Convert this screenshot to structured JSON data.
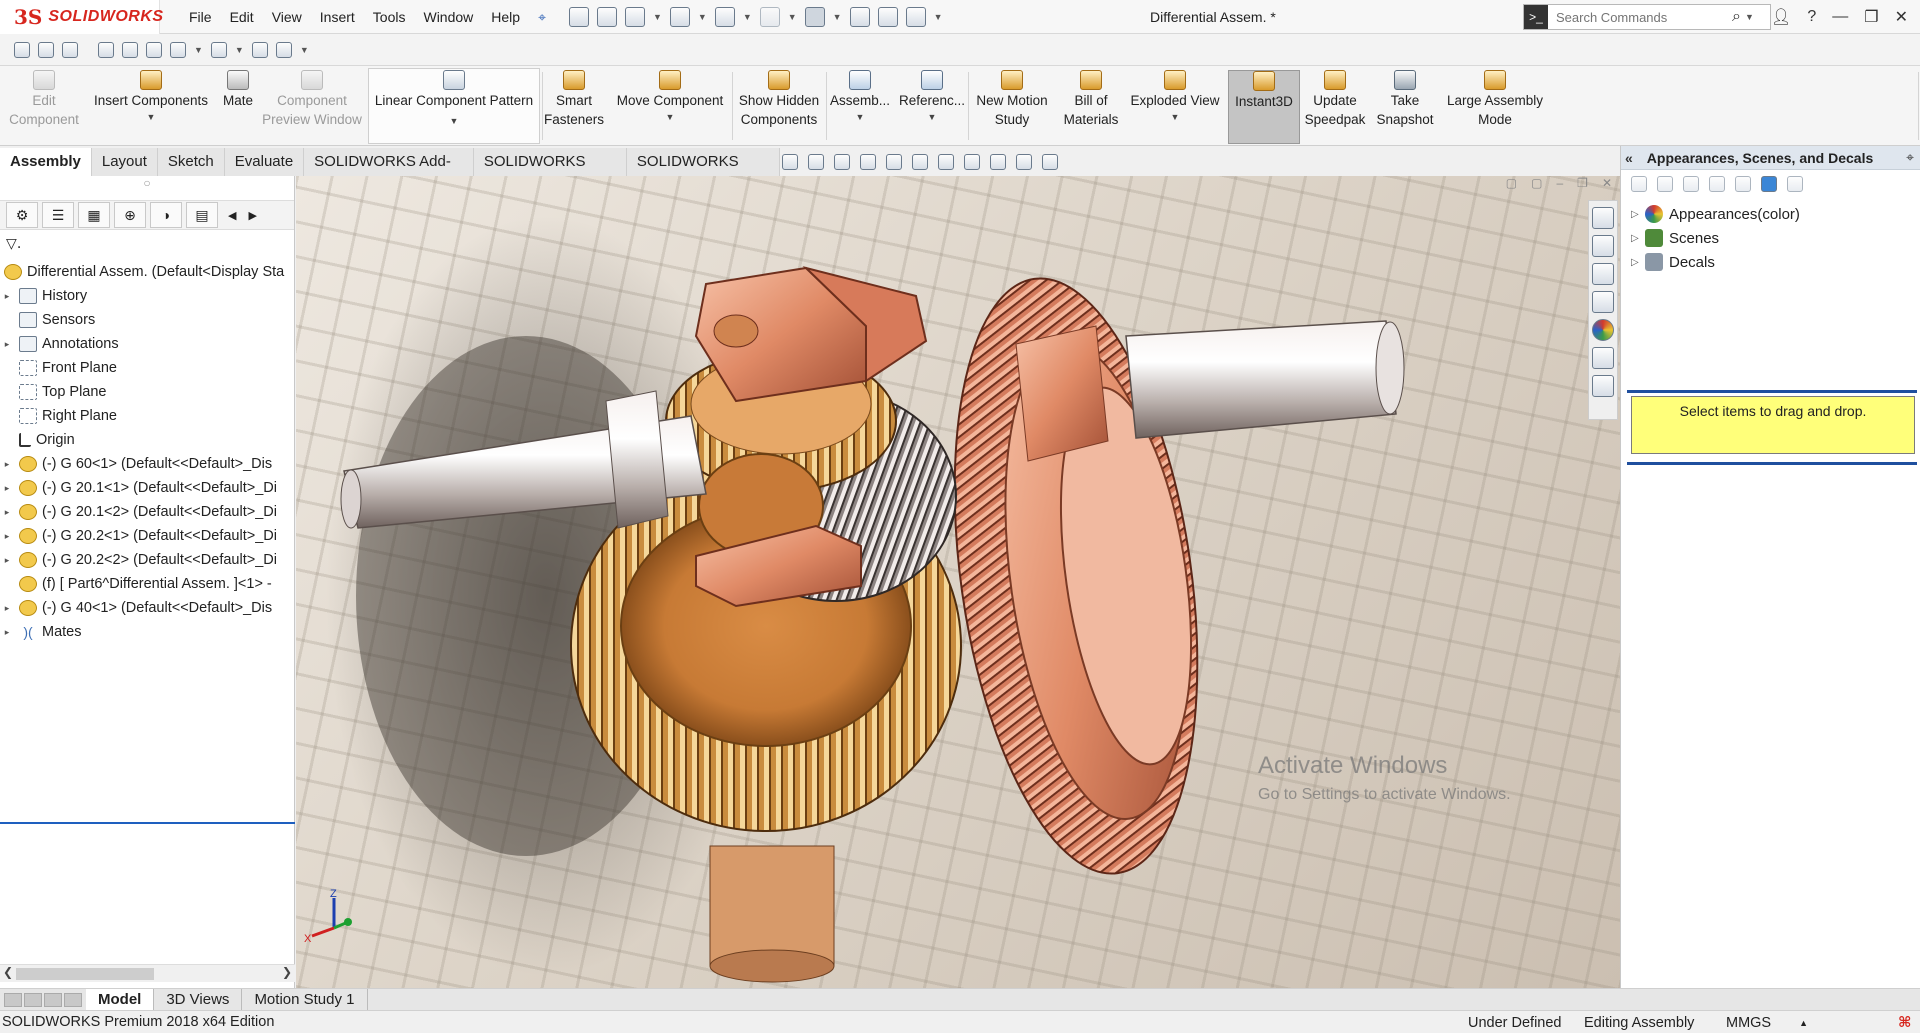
{
  "app": {
    "brand": "SOLIDWORKS",
    "title": "Differential Assem. *",
    "menu": [
      "File",
      "Edit",
      "View",
      "Insert",
      "Tools",
      "Window",
      "Help"
    ],
    "search_placeholder": "Search Commands"
  },
  "command_manager": {
    "edit_component": [
      "Edit",
      "Component"
    ],
    "insert_components": "Insert Components",
    "mate": "Mate",
    "component_preview": [
      "Component",
      "Preview Window"
    ],
    "linear_pattern": "Linear Component Pattern",
    "smart_fasteners": [
      "Smart",
      "Fasteners"
    ],
    "move_component": "Move Component",
    "show_hidden": [
      "Show Hidden",
      "Components"
    ],
    "assembly_features": "Assemb...",
    "reference_geometry": "Referenc...",
    "new_motion_study": [
      "New Motion",
      "Study"
    ],
    "bill_of_materials": [
      "Bill of",
      "Materials"
    ],
    "exploded_view": "Exploded View",
    "instant3d": "Instant3D",
    "update_speedpak": [
      "Update",
      "Speedpak"
    ],
    "take_snapshot": [
      "Take",
      "Snapshot"
    ],
    "large_assembly": [
      "Large Assembly",
      "Mode"
    ]
  },
  "tabs": [
    "Assembly",
    "Layout",
    "Sketch",
    "Evaluate",
    "SOLIDWORKS Add-Ins",
    "SOLIDWORKS MBD",
    "SOLIDWORKS CAM"
  ],
  "feature_tree": {
    "root": "Differential Assem.  (Default<Display Sta",
    "items": [
      {
        "label": "History",
        "icon": "history-icon",
        "expandable": true
      },
      {
        "label": "Sensors",
        "icon": "sensors-icon",
        "expandable": false
      },
      {
        "label": "Annotations",
        "icon": "annotations-icon",
        "expandable": true
      },
      {
        "label": "Front Plane",
        "icon": "plane-icon",
        "expandable": false
      },
      {
        "label": "Top Plane",
        "icon": "plane-icon",
        "expandable": false
      },
      {
        "label": "Right Plane",
        "icon": "plane-icon",
        "expandable": false
      },
      {
        "label": "Origin",
        "icon": "origin-icon",
        "expandable": false
      },
      {
        "label": "(-) G 60<1> (Default<<Default>_Dis",
        "icon": "part-icon",
        "expandable": true
      },
      {
        "label": "(-) G 20.1<1> (Default<<Default>_Di",
        "icon": "part-icon",
        "expandable": true
      },
      {
        "label": "(-) G 20.1<2> (Default<<Default>_Di",
        "icon": "part-icon",
        "expandable": true
      },
      {
        "label": "(-) G 20.2<1> (Default<<Default>_Di",
        "icon": "part-icon",
        "expandable": true
      },
      {
        "label": "(-) G 20.2<2> (Default<<Default>_Di",
        "icon": "part-icon",
        "expandable": true
      },
      {
        "label": "(f) [ Part6^Differential Assem. ]<1> -",
        "icon": "virtual-part-icon",
        "expandable": false
      },
      {
        "label": "(-) G 40<1> (Default<<Default>_Dis",
        "icon": "part-icon",
        "expandable": true
      },
      {
        "label": "Mates",
        "icon": "mates-icon",
        "expandable": true
      }
    ]
  },
  "task_pane": {
    "title": "Appearances, Scenes, and Decals",
    "items": [
      {
        "label": "Appearances(color)",
        "color": "#d23b2e"
      },
      {
        "label": "Scenes",
        "color": "#4f8a3a"
      },
      {
        "label": "Decals",
        "color": "#8a97a6"
      }
    ],
    "drop_hint": "Select items to drag and drop."
  },
  "bottom_tabs": [
    "Model",
    "3D Views",
    "Motion Study 1"
  ],
  "watermark": [
    "Activate Windows",
    "Go to Settings to activate Windows."
  ],
  "status": {
    "edition": "SOLIDWORKS Premium 2018 x64 Edition",
    "state": "Under Defined",
    "mode": "Editing Assembly",
    "units": "MMGS"
  },
  "triad": {
    "z": "Z",
    "x": "X"
  }
}
